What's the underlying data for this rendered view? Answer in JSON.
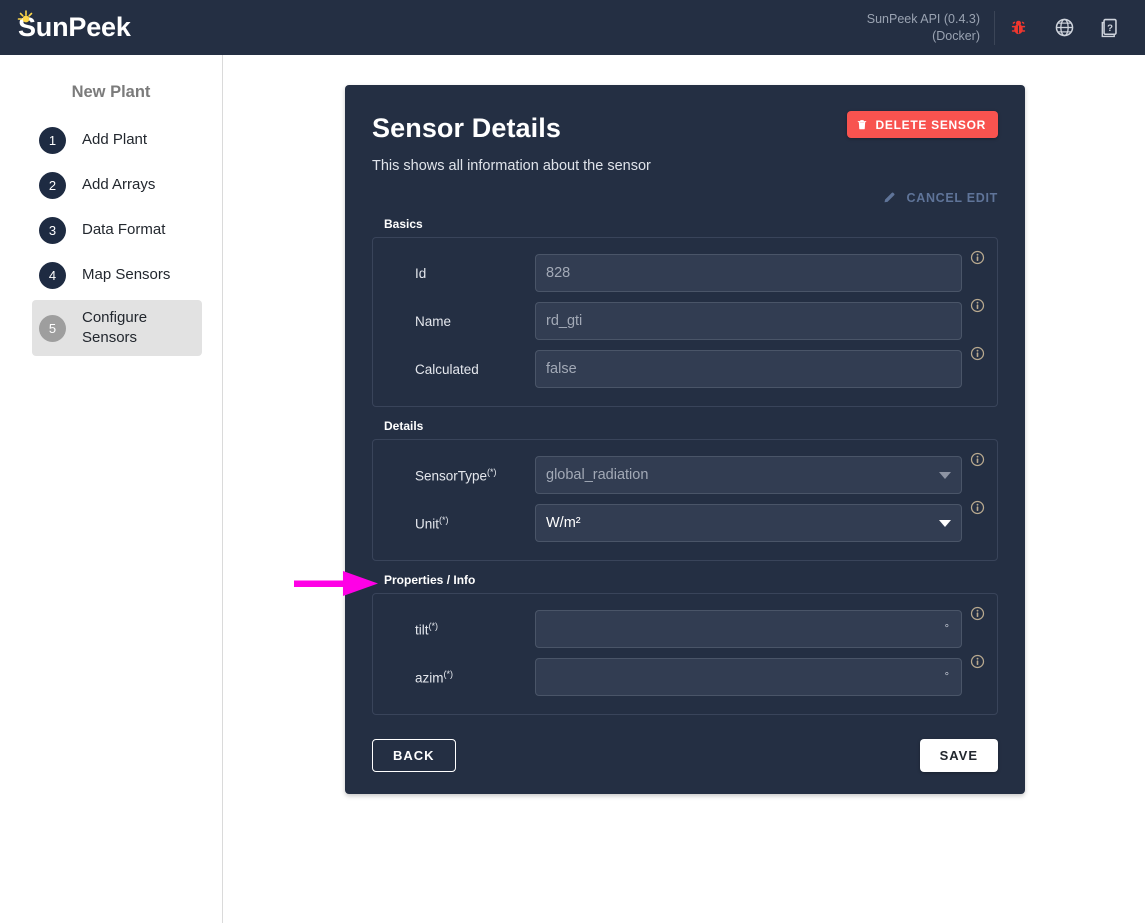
{
  "topbar": {
    "brand": "SunPeek",
    "brand_icon": "sun-icon",
    "api_line1": "SunPeek API (0.4.3)",
    "api_line2": "(Docker)",
    "icons": [
      {
        "name": "bug-icon",
        "color": "#f0372e"
      },
      {
        "name": "globe-icon",
        "color": "#cfd4dc"
      },
      {
        "name": "help-docs-icon",
        "color": "#cfd4dc"
      }
    ]
  },
  "sidebar": {
    "title": "New Plant",
    "items": [
      {
        "number": "1",
        "label": "Add Plant",
        "active": false
      },
      {
        "number": "2",
        "label": "Add Arrays",
        "active": false
      },
      {
        "number": "3",
        "label": "Data Format",
        "active": false
      },
      {
        "number": "4",
        "label": "Map Sensors",
        "active": false
      },
      {
        "number": "5",
        "label": "Configure Sensors",
        "active": true
      }
    ]
  },
  "card": {
    "title": "Sensor Details",
    "subtitle": "This shows all information about the sensor",
    "delete_label": "DELETE SENSOR",
    "delete_icon": "trash-icon",
    "cancel_label": "CANCEL EDIT",
    "cancel_icon": "pencil-icon",
    "sections": {
      "basics": {
        "label": "Basics",
        "fields": [
          {
            "label": "Id",
            "value": "828",
            "state": "disabled",
            "suffix": ""
          },
          {
            "label": "Name",
            "value": "rd_gti",
            "state": "disabled",
            "suffix": ""
          },
          {
            "label": "Calculated",
            "value": "false",
            "state": "disabled",
            "suffix": ""
          }
        ]
      },
      "details": {
        "label": "Details",
        "fields": [
          {
            "label": "SensorType",
            "required": "(*)",
            "value": "global_radiation",
            "state": "disabled",
            "control": "select"
          },
          {
            "label": "Unit",
            "required": "(*)",
            "value": "W/m²",
            "state": "active",
            "control": "select"
          }
        ]
      },
      "properties": {
        "label": "Properties / Info",
        "fields": [
          {
            "label": "tilt",
            "required": "(*)",
            "value": "",
            "state": "empty",
            "suffix": "°"
          },
          {
            "label": "azim",
            "required": "(*)",
            "value": "",
            "state": "empty",
            "suffix": "°"
          }
        ]
      }
    },
    "footer": {
      "back_label": "BACK",
      "save_label": "SAVE"
    }
  },
  "annotation": {
    "type": "arrow",
    "name": "properties-info-pointer-arrow",
    "color": "#ff00e6",
    "points_to": "Properties / Info"
  },
  "colors": {
    "topbar_bg": "#242f43",
    "card_bg": "#242f43",
    "field_bg": "#323d52",
    "accent_delete": "#f8534f",
    "accent_cancel": "#5f7499",
    "sidebar_active_bg": "#e2e2e2",
    "annotation": "#ff00e6"
  }
}
